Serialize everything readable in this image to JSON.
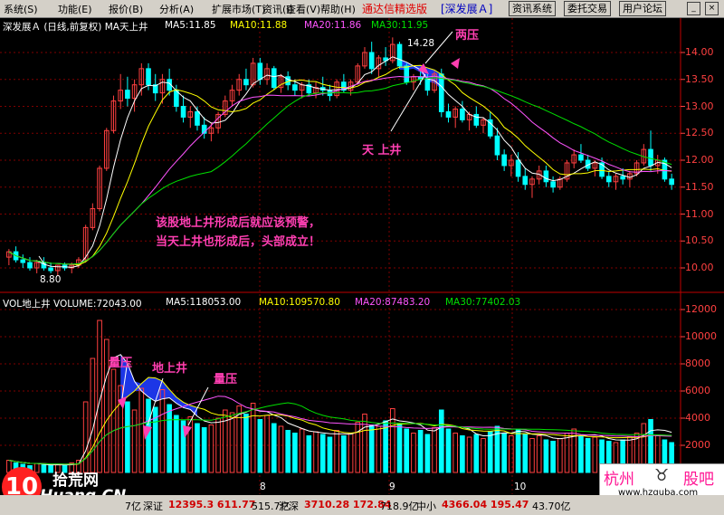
{
  "menu": {
    "items": [
      "系统(S)",
      "功能(E)",
      "报价(B)",
      "分析(A)",
      "扩展市场(T)",
      "资讯(I)",
      "查看(V)",
      "帮助(H)"
    ],
    "app_title": "通达信精选版",
    "stock_tab": "[深发展Ａ]",
    "buttons": [
      "资讯系统",
      "委托交易",
      "用户论坛"
    ],
    "win_min": "_",
    "win_close": "×"
  },
  "price_panel": {
    "header": "深发展Ａ (日线,前复权) MA天上井",
    "ma5": "MA5:11.85",
    "ma10": "MA10:11.88",
    "ma20": "MA20:11.86",
    "ma30": "MA30:11.95",
    "yticks": [
      "14.00",
      "13.50",
      "13.00",
      "12.50",
      "12.00",
      "11.50",
      "11.00",
      "10.50",
      "10.00"
    ],
    "high_label": "14.28",
    "low_label": "8.80",
    "annot_liangya": "两压",
    "annot_tianshangjing": "天 上井",
    "annot_warning1": "该股地上井形成后就应该预警，",
    "annot_warning2": "当天上井也形成后，头部成立！",
    "colors": {
      "ma5": "#ffffff",
      "ma10": "#ffff00",
      "ma20": "#ff55ff",
      "ma30": "#00e000",
      "up": "#ff4040",
      "down": "#00ffff",
      "label": "#ff4040"
    }
  },
  "volume_panel": {
    "header": "VOL地上井 VOLUME:72043.00",
    "ma5": "MA5:118053.00",
    "ma10": "MA10:109570.80",
    "ma20": "MA20:87483.20",
    "ma30": "MA30:77402.03",
    "yticks": [
      "12000",
      "10000",
      "8000",
      "6000",
      "4000",
      "2000"
    ],
    "annot_liangya1": "量压",
    "annot_dishangjing": "地上井",
    "annot_liangya2": "量压"
  },
  "date_axis": [
    "8",
    "9",
    "10"
  ],
  "status_bar": {
    "first_partial": "7亿",
    "shenzheng_label": "深证",
    "shenzheng_values": "12395.3 611.77",
    "shenzheng_amt": "515.7亿",
    "hushen_label": "沪深",
    "hushen_values": "3710.28 172.84",
    "hushen_amt": "718.9亿",
    "zhongxiao_label": "中小",
    "zhongxiao_values": "4366.04 195.47",
    "zhongxiao_amt": "43.70亿"
  },
  "watermark_left": {
    "logo": "10",
    "name": "拾荒网",
    "url": "Huang.CN"
  },
  "watermark_right": {
    "city": "杭州",
    "name": "股吧",
    "url": "www.hzguba.com"
  },
  "candles": [
    [
      10.2,
      10.35,
      10.05,
      10.3
    ],
    [
      10.3,
      10.4,
      10.1,
      10.15
    ],
    [
      10.15,
      10.25,
      10.0,
      10.1
    ],
    [
      10.1,
      10.2,
      9.95,
      10.0
    ],
    [
      10.0,
      10.15,
      9.9,
      10.1
    ],
    [
      10.1,
      10.2,
      9.95,
      10.0
    ],
    [
      10.0,
      10.1,
      9.9,
      9.95
    ],
    [
      9.95,
      10.05,
      9.85,
      10.05
    ],
    [
      10.05,
      10.1,
      9.95,
      10.0
    ],
    [
      10.0,
      10.1,
      9.9,
      10.05
    ],
    [
      10.05,
      10.2,
      10.0,
      10.15
    ],
    [
      10.15,
      10.8,
      10.1,
      10.75
    ],
    [
      10.75,
      11.2,
      10.7,
      11.1
    ],
    [
      11.1,
      11.9,
      11.05,
      11.85
    ],
    [
      11.85,
      12.6,
      11.8,
      12.55
    ],
    [
      12.55,
      13.2,
      12.5,
      13.1
    ],
    [
      13.1,
      13.6,
      12.95,
      13.3
    ],
    [
      13.3,
      13.55,
      13.0,
      13.15
    ],
    [
      13.15,
      13.5,
      12.9,
      13.4
    ],
    [
      13.4,
      13.8,
      13.2,
      13.7
    ],
    [
      13.7,
      13.8,
      13.3,
      13.4
    ],
    [
      13.4,
      13.6,
      13.1,
      13.25
    ],
    [
      13.25,
      13.6,
      13.05,
      13.5
    ],
    [
      13.5,
      13.7,
      13.2,
      13.3
    ],
    [
      13.3,
      13.4,
      12.9,
      13.0
    ],
    [
      13.0,
      13.2,
      12.7,
      12.8
    ],
    [
      12.8,
      13.0,
      12.6,
      12.9
    ],
    [
      12.9,
      13.0,
      12.55,
      12.65
    ],
    [
      12.65,
      12.8,
      12.4,
      12.5
    ],
    [
      12.5,
      12.7,
      12.35,
      12.6
    ],
    [
      12.6,
      12.9,
      12.5,
      12.85
    ],
    [
      12.85,
      13.2,
      12.8,
      13.1
    ],
    [
      13.1,
      13.4,
      13.0,
      13.3
    ],
    [
      13.3,
      13.6,
      13.2,
      13.5
    ],
    [
      13.5,
      13.7,
      13.3,
      13.4
    ],
    [
      13.4,
      13.9,
      13.35,
      13.8
    ],
    [
      13.8,
      13.9,
      13.4,
      13.5
    ],
    [
      13.5,
      13.8,
      13.4,
      13.7
    ],
    [
      13.7,
      13.75,
      13.3,
      13.35
    ],
    [
      13.35,
      13.6,
      13.25,
      13.55
    ],
    [
      13.55,
      13.65,
      13.3,
      13.4
    ],
    [
      13.4,
      13.5,
      13.2,
      13.3
    ],
    [
      13.3,
      13.45,
      13.15,
      13.4
    ],
    [
      13.4,
      13.5,
      13.2,
      13.25
    ],
    [
      13.25,
      13.45,
      13.15,
      13.35
    ],
    [
      13.35,
      13.55,
      13.2,
      13.3
    ],
    [
      13.3,
      13.4,
      13.1,
      13.2
    ],
    [
      13.2,
      13.5,
      13.15,
      13.45
    ],
    [
      13.45,
      13.6,
      13.25,
      13.3
    ],
    [
      13.3,
      13.5,
      13.2,
      13.45
    ],
    [
      13.45,
      13.8,
      13.4,
      13.75
    ],
    [
      13.75,
      14.1,
      13.7,
      14.0
    ],
    [
      14.0,
      14.2,
      13.6,
      13.7
    ],
    [
      13.7,
      13.95,
      13.55,
      13.9
    ],
    [
      13.9,
      14.1,
      13.75,
      13.85
    ],
    [
      13.85,
      14.28,
      13.8,
      14.15
    ],
    [
      14.15,
      14.2,
      13.7,
      13.75
    ],
    [
      13.75,
      13.8,
      13.4,
      13.45
    ],
    [
      13.45,
      13.6,
      13.3,
      13.55
    ],
    [
      13.55,
      13.7,
      13.4,
      13.5
    ],
    [
      13.5,
      13.6,
      13.2,
      13.3
    ],
    [
      13.3,
      13.65,
      13.25,
      13.6
    ],
    [
      13.6,
      13.7,
      12.8,
      12.9
    ],
    [
      12.9,
      13.05,
      12.7,
      12.8
    ],
    [
      12.8,
      13.0,
      12.6,
      12.95
    ],
    [
      12.95,
      13.1,
      12.7,
      12.75
    ],
    [
      12.75,
      12.9,
      12.55,
      12.85
    ],
    [
      12.85,
      13.0,
      12.6,
      12.65
    ],
    [
      12.65,
      12.8,
      12.5,
      12.75
    ],
    [
      12.75,
      12.9,
      12.4,
      12.45
    ],
    [
      12.45,
      12.6,
      12.0,
      12.1
    ],
    [
      12.1,
      12.2,
      11.8,
      11.9
    ],
    [
      11.9,
      12.1,
      11.7,
      12.0
    ],
    [
      12.0,
      12.15,
      11.6,
      11.7
    ],
    [
      11.7,
      11.85,
      11.45,
      11.55
    ],
    [
      11.55,
      11.7,
      11.3,
      11.65
    ],
    [
      11.65,
      11.9,
      11.55,
      11.8
    ],
    [
      11.8,
      11.9,
      11.5,
      11.6
    ],
    [
      11.6,
      11.7,
      11.4,
      11.5
    ],
    [
      11.5,
      11.7,
      11.45,
      11.65
    ],
    [
      11.65,
      12.0,
      11.6,
      11.95
    ],
    [
      11.95,
      12.2,
      11.85,
      12.1
    ],
    [
      12.1,
      12.3,
      11.95,
      12.0
    ],
    [
      12.0,
      12.1,
      11.8,
      11.85
    ],
    [
      11.85,
      12.0,
      11.7,
      11.95
    ],
    [
      11.95,
      12.05,
      11.65,
      11.7
    ],
    [
      11.7,
      11.8,
      11.5,
      11.6
    ],
    [
      11.6,
      11.75,
      11.45,
      11.7
    ],
    [
      11.7,
      11.85,
      11.55,
      11.65
    ],
    [
      11.65,
      11.8,
      11.5,
      11.75
    ],
    [
      11.75,
      12.0,
      11.7,
      11.95
    ],
    [
      11.95,
      12.3,
      11.9,
      12.2
    ],
    [
      12.2,
      12.55,
      11.8,
      11.9
    ],
    [
      11.9,
      12.1,
      11.75,
      12.0
    ],
    [
      12.0,
      12.05,
      11.6,
      11.65
    ],
    [
      11.65,
      11.75,
      11.45,
      11.55
    ]
  ],
  "volumes": [
    900,
    700,
    600,
    500,
    650,
    550,
    500,
    600,
    500,
    700,
    900,
    5200,
    8400,
    11200,
    9800,
    7600,
    6400,
    5200,
    4600,
    6200,
    5400,
    4800,
    6100,
    5000,
    4200,
    3800,
    4100,
    3600,
    3300,
    3500,
    4000,
    4600,
    4400,
    4900,
    4300,
    5100,
    3900,
    4200,
    3600,
    3400,
    3100,
    2900,
    3200,
    2700,
    3000,
    2800,
    2600,
    3100,
    2700,
    2900,
    3700,
    4300,
    3500,
    3400,
    3800,
    4700,
    3600,
    3200,
    2900,
    3100,
    2800,
    3300,
    4600,
    3200,
    2900,
    2700,
    2600,
    2800,
    2500,
    3000,
    3400,
    2900,
    2700,
    3200,
    2800,
    2500,
    2700,
    2400,
    2300,
    2500,
    2900,
    3200,
    2700,
    2500,
    2600,
    2400,
    2300,
    2200,
    2400,
    2600,
    2900,
    3600,
    3900,
    2700,
    2400,
    2200
  ]
}
